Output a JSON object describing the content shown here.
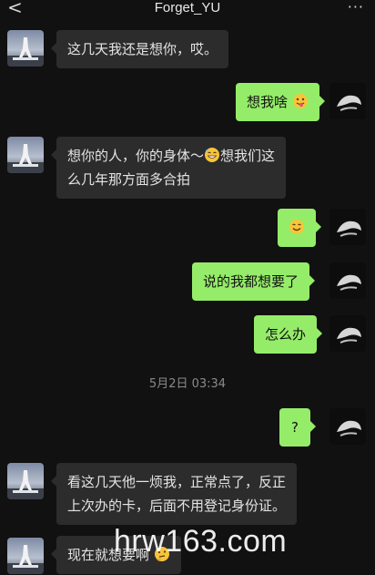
{
  "header": {
    "back_glyph": "<",
    "title": "Forget_YU",
    "more_glyph": "···"
  },
  "messages": [
    {
      "side": "in",
      "text": "这几天我还是想你，哎。"
    },
    {
      "side": "out",
      "text": "想我啥",
      "trailing_emoji": "tongue-face-emoji"
    },
    {
      "side": "in",
      "text_line1_a": "想你的人，你的身体～",
      "text_line1_emoji": "grin-face-emoji",
      "text_line1_b": "想我们这",
      "text_line2": "么几年那方面多合拍"
    },
    {
      "side": "out",
      "emoji_only": "smile-face-emoji"
    },
    {
      "side": "out",
      "text": "说的我都想要了"
    },
    {
      "side": "out",
      "text": "怎么办"
    },
    {
      "side": "out",
      "text": "?"
    },
    {
      "side": "in",
      "text_line1": "看这几天他一烦我，正常点了，反正",
      "text_line2": "上次办的卡，后面不用登记身份证。"
    },
    {
      "side": "in",
      "text": "现在就想要啊",
      "trailing_emoji": "thinking-face-emoji"
    }
  ],
  "timestamp": "5月2日 03:34",
  "watermark": "hrw163.com",
  "colors": {
    "background": "#111111",
    "incoming_bubble": "#2c2c2c",
    "outgoing_bubble": "#95ec69"
  }
}
